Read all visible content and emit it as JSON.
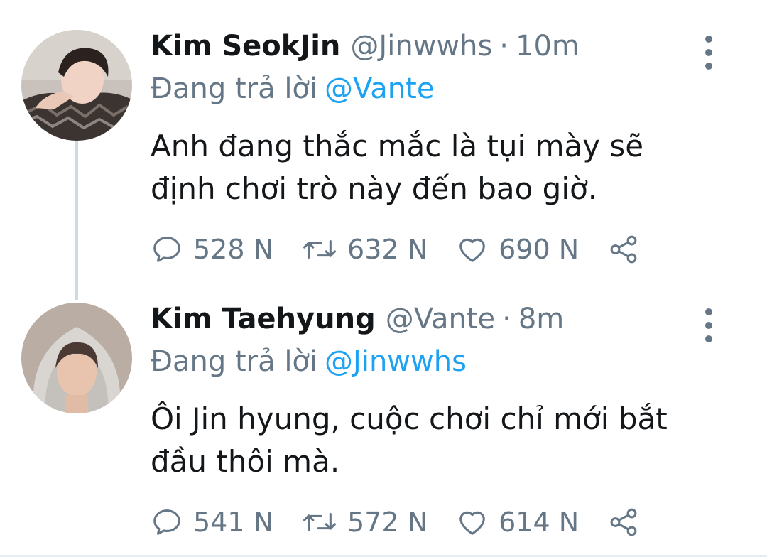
{
  "thread": {
    "tweets": [
      {
        "name": "Kim SeokJin",
        "handle": "@Jinwwhs",
        "separator": "·",
        "time": "10m",
        "replying_label": "Đang trả lời",
        "replying_to": "@Vante",
        "text_lines": [
          "Anh đang thắc mắc là tụi mày sẽ",
          "định chơi trò này đến bao giờ."
        ],
        "replies": "528 N",
        "retweets": "632 N",
        "likes": "690 N"
      },
      {
        "name": "Kim Taehyung",
        "handle": "@Vante",
        "separator": "·",
        "time": "8m",
        "replying_label": "Đang trả lời",
        "replying_to": "@Jinwwhs",
        "text_lines": [
          "Ôi Jin hyung, cuộc chơi chỉ mới bắt",
          "đầu thôi mà."
        ],
        "replies": "541 N",
        "retweets": "572 N",
        "likes": "614 N"
      }
    ]
  },
  "colors": {
    "text": "#14171a",
    "secondary": "#657786",
    "link": "#1da1f2",
    "thread_line": "#cfd9de"
  },
  "icons": {
    "reply": "reply-icon",
    "retweet": "retweet-icon",
    "like": "heart-icon",
    "share": "share-icon",
    "more": "more-vertical-icon"
  }
}
